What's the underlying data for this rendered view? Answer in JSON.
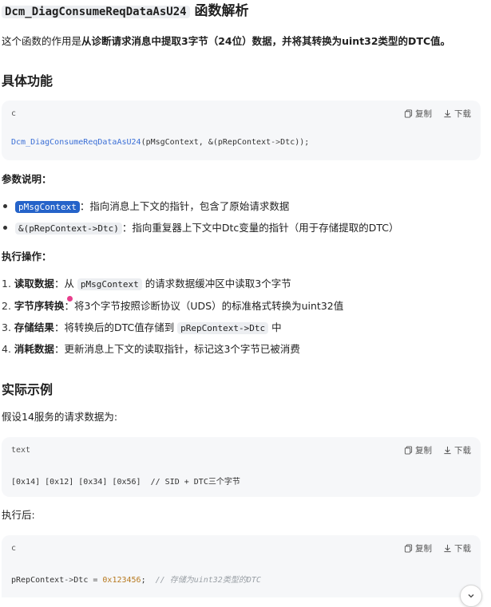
{
  "title": {
    "function_name": "Dcm_DiagConsumeReqDataAsU24",
    "suffix": "函数解析"
  },
  "intro": {
    "prefix": "这个函数的作用是",
    "bold": "从诊断请求消息中提取3字节（24位）数据，并将其转换为uint32类型的DTC值。"
  },
  "section_function": "具体功能",
  "code_block_labels": {
    "copy": "复制",
    "download": "下载"
  },
  "code1": {
    "lang": "c",
    "fn": "Dcm_DiagConsumeReqDataAsU24",
    "args_a": "(pMsgContext, &(pRepContext",
    "arrow": "->",
    "args_b": "Dtc));"
  },
  "params_heading": "参数说明：",
  "params": [
    {
      "chip": "pMsgContext",
      "text": "：指向消息上下文的指针，包含了原始请求数据"
    },
    {
      "chip": "&(pRepContext->Dtc)",
      "text": "：指向重复器上下文中Dtc变量的指针（用于存储提取的DTC）"
    }
  ],
  "ops_heading": "执行操作：",
  "ops": [
    {
      "num": "1.",
      "bold": "读取数据",
      "a": "：从 ",
      "chip": "pMsgContext",
      "b": " 的请求数据缓冲区中读取3个字节"
    },
    {
      "num": "2.",
      "bold": "字节序转换",
      "a": "：将3个字节按照诊断协议（UDS）的标准格式转换为uint32值",
      "chip": "",
      "b": ""
    },
    {
      "num": "3.",
      "bold": "存储结果",
      "a": "：将转换后的DTC值存储到 ",
      "chip": "pRepContext->Dtc",
      "b": " 中"
    },
    {
      "num": "4.",
      "bold": "消耗数据",
      "a": "：更新消息上下文的读取指针，标记这3个字节已被消费",
      "chip": "",
      "b": ""
    }
  ],
  "section_example": "实际示例",
  "example_intro": "假设14服务的请求数据为:",
  "code2": {
    "lang": "text",
    "line": "[0x14] [0x12] [0x34] [0x56]  // SID + DTC三个字节"
  },
  "after_label": "执行后:",
  "code3": {
    "lang": "c",
    "lhs": "pRepContext",
    "arrow": "->",
    "field": "Dtc",
    "eq": " = ",
    "value": "0x123456",
    "semi": ";  ",
    "comment": "// 存储为uint32类型的DTC"
  },
  "icons": [
    "copy-icon",
    "download-icon",
    "chevron-down-icon"
  ]
}
